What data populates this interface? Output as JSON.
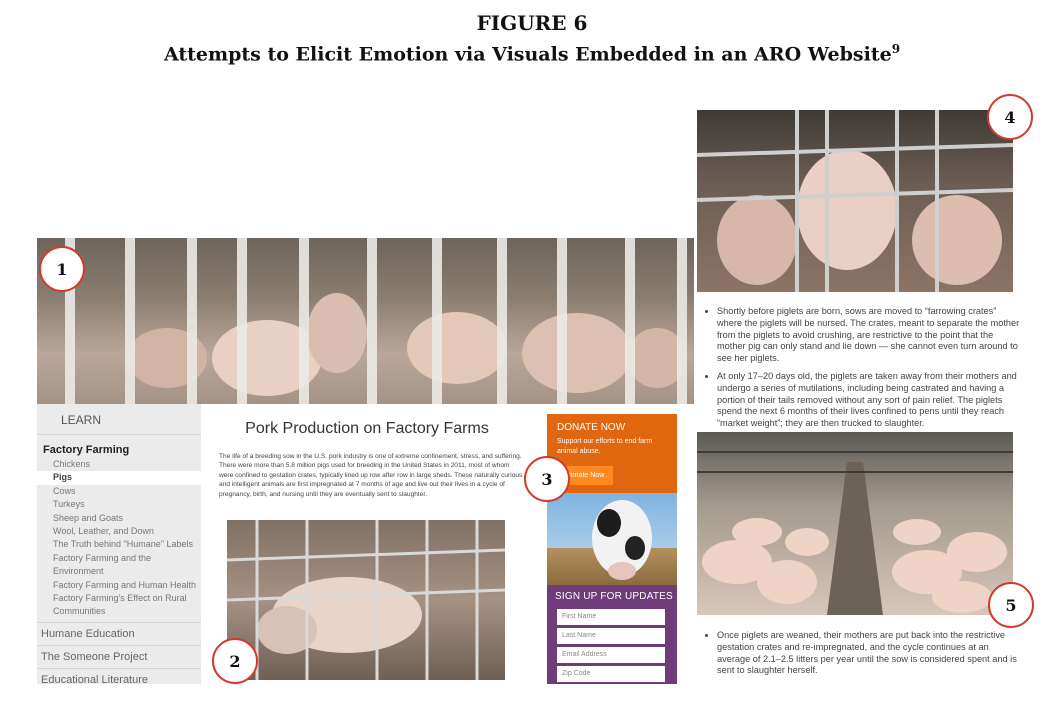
{
  "figure": {
    "label": "FIGURE 6",
    "title": "Attempts to Elicit Emotion via Visuals Embedded in an ARO Website",
    "footnote": "9"
  },
  "markers": [
    "1",
    "2",
    "3",
    "4",
    "5"
  ],
  "sidebar": {
    "learn": "LEARN",
    "heading": "Factory Farming",
    "items": [
      "Chickens",
      "Pigs",
      "Cows",
      "Turkeys",
      "Sheep and Goats",
      "Wool, Leather, and Down",
      "The Truth behind \"Humane\" Labels",
      "Factory Farming and the Environment",
      "Factory Farming and Human Health",
      "Factory Farming's Effect on Rural",
      "Communities"
    ],
    "sections": [
      "Humane Education",
      "The Someone Project",
      "Educational Literature"
    ]
  },
  "article": {
    "title": "Pork Production on Factory Farms",
    "body": "The life of a breeding sow in the U.S. pork industry is one of extreme confinement, stress, and suffering. There were more than 5.8 million pigs used for breeding in the United States in 2011, most of whom were confined to gestation crates, typically lined up row after row in large sheds. These naturally curious and intelligent animals are first impregnated at 7 months of age and live out their lives in a cycle of pregnancy, birth, and nursing until they are eventually sent to slaughter."
  },
  "donate": {
    "title": "DONATE NOW",
    "subtitle": "Support our efforts to end farm animal abuse.",
    "button": "Donate Now"
  },
  "signup": {
    "title": "SIGN UP FOR UPDATES",
    "fields": [
      "First Name",
      "Last Name",
      "Email Address",
      "Zip Code"
    ]
  },
  "right_text": {
    "bullet1": "Shortly before piglets are born, sows are moved to “farrowing crates” where the piglets will be nursed. The crates, meant to separate the mother from the piglets to avoid crushing, are restrictive to the point that the mother pig can only stand and lie down — she cannot even turn around to see her piglets.",
    "bullet2": "At only 17–20 days old, the piglets are taken away from their mothers and undergo a series of mutilations, including being castrated and having a portion of their tails removed without any sort of pain relief. The piglets spend the next 6 months of their lives confined to pens until they reach “market weight”; they are then trucked to slaughter.",
    "bullet3": "Once piglets are weaned, their mothers are put back into the restrictive gestation crates and re-impregnated, and the cycle continues at an average of 2.1–2.5 litters per year until the sow is considered spent and is sent to slaughter herself."
  },
  "colors": {
    "donate": "#e0660f",
    "signup": "#6f3b7a",
    "marker_ring": "#d23a2a"
  }
}
